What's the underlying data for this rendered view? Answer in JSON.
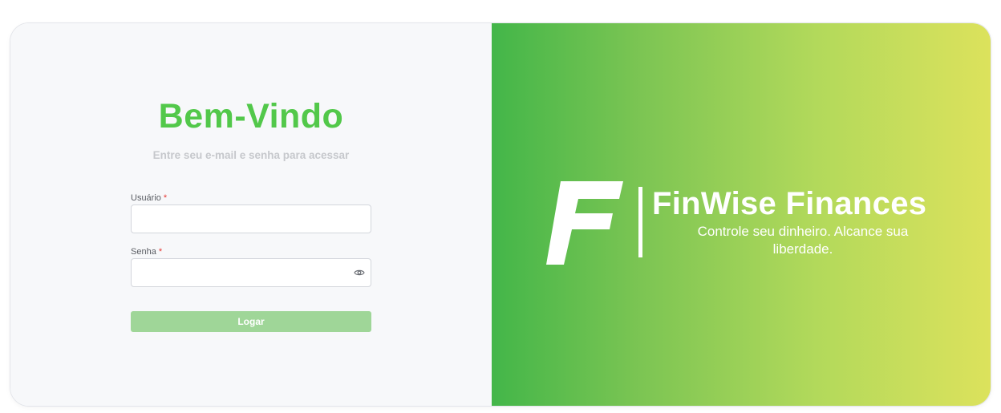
{
  "login": {
    "title": "Bem-Vindo",
    "subtitle": "Entre seu e-mail e senha para acessar",
    "username": {
      "label": "Usuário",
      "required_mark": "*",
      "value": "",
      "placeholder": ""
    },
    "password": {
      "label": "Senha",
      "required_mark": "*",
      "value": "",
      "placeholder": "",
      "toggle_icon": "eye-icon"
    },
    "submit_label": "Logar"
  },
  "brand": {
    "logo_letter": "F",
    "name": "FinWise Finances",
    "tagline": "Controle seu dinheiro. Alcance sua liberdade."
  },
  "colors": {
    "accent": "#52c84a",
    "button": "#9fd698",
    "gradient_start": "#43b649",
    "gradient_end": "#dce25c",
    "required": "#e53935"
  }
}
